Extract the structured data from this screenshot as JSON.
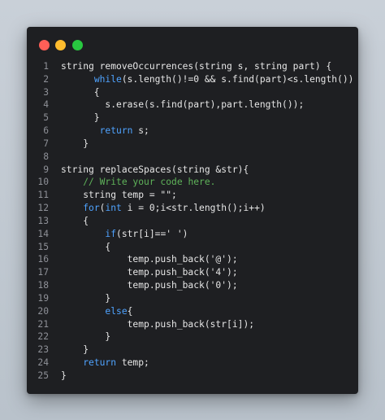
{
  "window": {
    "controls": [
      {
        "name": "close-button",
        "color": "#ff5f57"
      },
      {
        "name": "minimize-button",
        "color": "#febc2e"
      },
      {
        "name": "maximize-button",
        "color": "#28c840"
      }
    ]
  },
  "colors": {
    "background": "#1e1f22",
    "text": "#e6e6e6",
    "keyword": "#4fa3ff",
    "comment": "#5fb35a",
    "line_number": "#8e9097"
  },
  "code": {
    "lines": [
      {
        "n": "1",
        "tokens": [
          {
            "t": "string removeOccurrences(string s, string part) {"
          }
        ]
      },
      {
        "n": "2",
        "tokens": [
          {
            "t": "      "
          },
          {
            "t": "while",
            "k": "kw"
          },
          {
            "t": "(s.length()!=0 && s.find(part)<s.length())"
          }
        ]
      },
      {
        "n": "3",
        "tokens": [
          {
            "t": "      {"
          }
        ]
      },
      {
        "n": "4",
        "tokens": [
          {
            "t": "        s.erase(s.find(part),part.length());"
          }
        ]
      },
      {
        "n": "5",
        "tokens": [
          {
            "t": "      }"
          }
        ]
      },
      {
        "n": "6",
        "tokens": [
          {
            "t": "       "
          },
          {
            "t": "return",
            "k": "kw"
          },
          {
            "t": " s;"
          }
        ]
      },
      {
        "n": "7",
        "tokens": [
          {
            "t": "    }"
          }
        ]
      },
      {
        "n": "8",
        "tokens": [
          {
            "t": ""
          }
        ]
      },
      {
        "n": "9",
        "tokens": [
          {
            "t": "string replaceSpaces(string &str){"
          }
        ]
      },
      {
        "n": "10",
        "tokens": [
          {
            "t": "    "
          },
          {
            "t": "// Write your code here.",
            "k": "cm"
          }
        ]
      },
      {
        "n": "11",
        "tokens": [
          {
            "t": "    string temp = \"\";"
          }
        ]
      },
      {
        "n": "12",
        "tokens": [
          {
            "t": "    "
          },
          {
            "t": "for",
            "k": "kw"
          },
          {
            "t": "("
          },
          {
            "t": "int",
            "k": "kw"
          },
          {
            "t": " i = 0;i<str.length();i++)"
          }
        ]
      },
      {
        "n": "13",
        "tokens": [
          {
            "t": "    {"
          }
        ]
      },
      {
        "n": "14",
        "tokens": [
          {
            "t": "        "
          },
          {
            "t": "if",
            "k": "kw"
          },
          {
            "t": "(str[i]==' ')"
          }
        ]
      },
      {
        "n": "15",
        "tokens": [
          {
            "t": "        {"
          }
        ]
      },
      {
        "n": "16",
        "tokens": [
          {
            "t": "            temp.push_back('@');"
          }
        ]
      },
      {
        "n": "17",
        "tokens": [
          {
            "t": "            temp.push_back('4');"
          }
        ]
      },
      {
        "n": "18",
        "tokens": [
          {
            "t": "            temp.push_back('0');"
          }
        ]
      },
      {
        "n": "19",
        "tokens": [
          {
            "t": "        }"
          }
        ]
      },
      {
        "n": "20",
        "tokens": [
          {
            "t": "        "
          },
          {
            "t": "else",
            "k": "kw"
          },
          {
            "t": "{"
          }
        ]
      },
      {
        "n": "21",
        "tokens": [
          {
            "t": "            temp.push_back(str[i]);"
          }
        ]
      },
      {
        "n": "22",
        "tokens": [
          {
            "t": "        }"
          }
        ]
      },
      {
        "n": "23",
        "tokens": [
          {
            "t": "    }"
          }
        ]
      },
      {
        "n": "24",
        "tokens": [
          {
            "t": "    "
          },
          {
            "t": "return",
            "k": "kw"
          },
          {
            "t": " temp;"
          }
        ]
      },
      {
        "n": "25",
        "tokens": [
          {
            "t": "}"
          }
        ]
      }
    ]
  }
}
